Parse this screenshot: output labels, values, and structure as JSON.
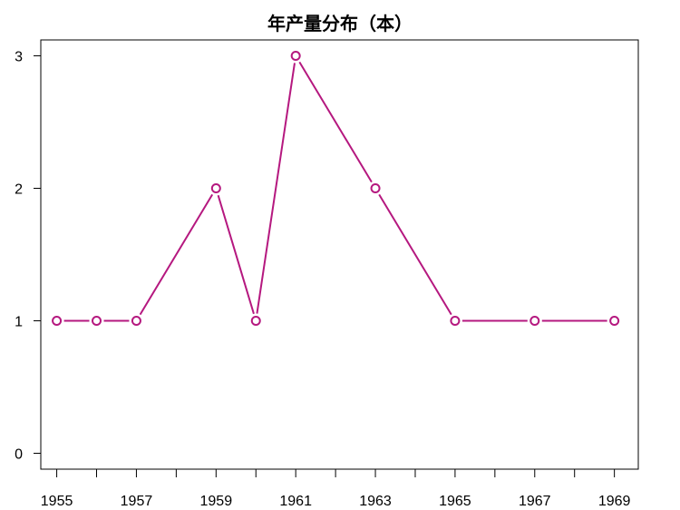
{
  "chart_data": {
    "type": "line",
    "title": "年产量分布（本）",
    "xlabel": "",
    "ylabel": "",
    "x": [
      1955,
      1956,
      1957,
      1959,
      1960,
      1961,
      1963,
      1965,
      1967,
      1969
    ],
    "series": [
      {
        "values": [
          1,
          1,
          1,
          2,
          1,
          3,
          2,
          1,
          1,
          1
        ]
      }
    ],
    "xlim": [
      1954.6,
      1969.6
    ],
    "ylim": [
      -0.12,
      3.12
    ],
    "x_ticks": [
      1955,
      1956,
      1957,
      1958,
      1959,
      1960,
      1961,
      1962,
      1963,
      1964,
      1965,
      1966,
      1967,
      1968,
      1969
    ],
    "x_tick_labels": [
      "1955",
      "1957",
      "1959",
      "1961",
      "1963",
      "1965",
      "1967",
      "1969"
    ],
    "y_ticks": [
      0,
      1,
      2,
      3
    ],
    "y_tick_labels": [
      "0",
      "1",
      "2",
      "3"
    ],
    "grid": false,
    "line_color": "#B5187F",
    "marker": "open-circle"
  }
}
